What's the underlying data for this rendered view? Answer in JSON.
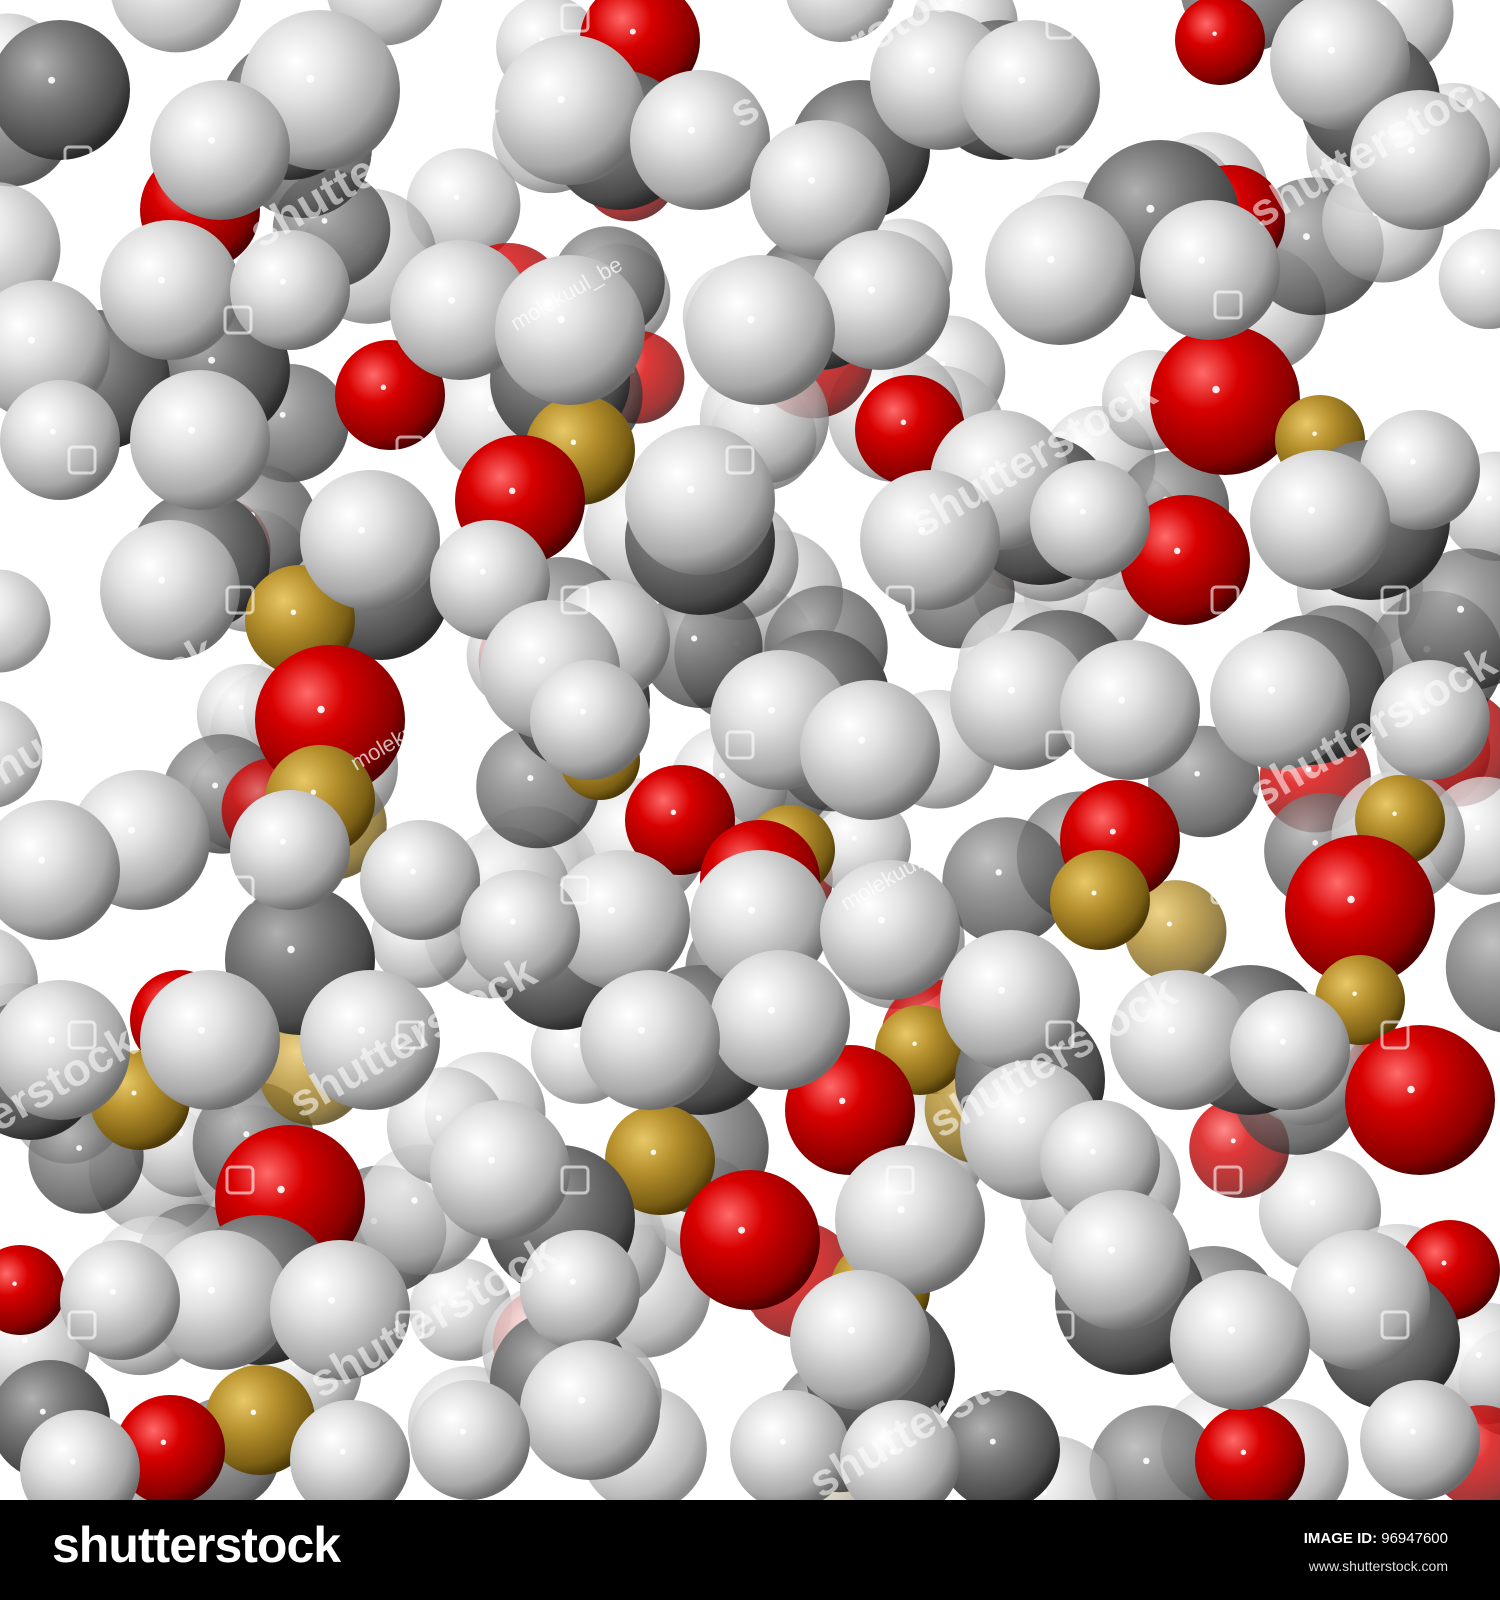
{
  "image": {
    "subject": "space-filling molecular model",
    "atom_colors": {
      "carbon": "#6e6e6e",
      "hydrogen": "#d8d8d8",
      "oxygen": "#c00000",
      "silicon": "#b0902a"
    }
  },
  "watermark": {
    "brand_text": "shutterstock",
    "author_text": "molekuul_be",
    "icon": "shutterstock-logo-icon"
  },
  "footer": {
    "brand": "shutterstock",
    "image_id_label": "IMAGE ID:",
    "image_id_value": "96947600",
    "site_url": "www.shutterstock.com",
    "background": "#000000"
  }
}
